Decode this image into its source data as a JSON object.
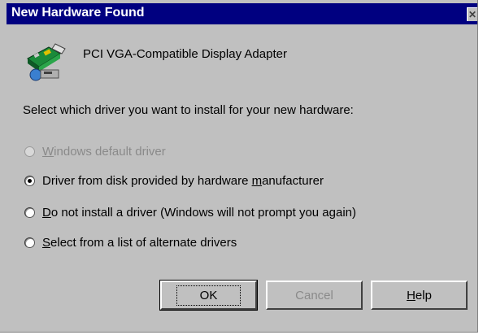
{
  "window": {
    "title": "New Hardware Found"
  },
  "device": {
    "name": "PCI VGA-Compatible Display Adapter"
  },
  "prompt": "Select which driver you want to install for your new hardware:",
  "options": [
    {
      "pre": "",
      "key": "W",
      "post": "indows default driver",
      "checked": false,
      "enabled": false
    },
    {
      "pre": "Driver from disk provided by hardware ",
      "key": "m",
      "post": "anufacturer",
      "checked": true,
      "enabled": true
    },
    {
      "pre": "",
      "key": "D",
      "post": "o not install a driver (Windows will not prompt you again)",
      "checked": false,
      "enabled": true
    },
    {
      "pre": "",
      "key": "S",
      "post": "elect from a list of alternate drivers",
      "checked": false,
      "enabled": true
    }
  ],
  "buttons": {
    "ok": "OK",
    "cancel": "Cancel",
    "help": {
      "key": "H",
      "rest": "elp"
    }
  },
  "colors": {
    "titlebar": "#000080",
    "face": "#c0c0c0"
  }
}
